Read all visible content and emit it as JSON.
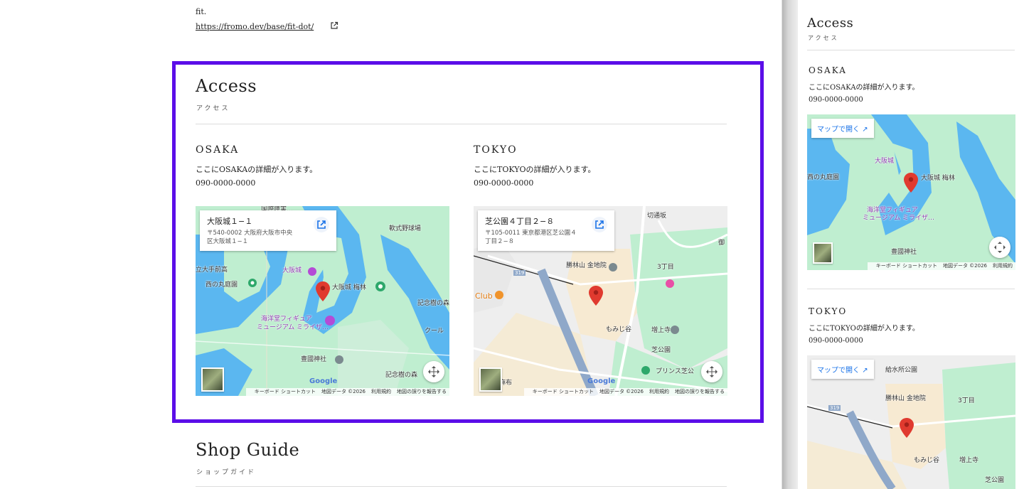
{
  "top": {
    "text": "fit.",
    "link": "https://fromo.dev/base/fit-dot/"
  },
  "access": {
    "title": "Access",
    "subtitle": "アクセス",
    "locations": [
      {
        "name": "OSAKA",
        "desc": "ここにOSAKAの詳細が入ります。",
        "phone": "090-0000-0000",
        "map": {
          "card_title": "大阪城１−１",
          "card_addr1": "〒540-0002 大阪府大阪市中央",
          "card_addr2": "区大阪城１−１",
          "labels": [
            "大阪城",
            "大阪城 梅林",
            "西の丸庭園",
            "立大手前高",
            "海洋堂フィギュア",
            "ミュージアム ミライザ…",
            "豊國神社",
            "軟式野球場",
            "記念樹の森",
            "クール",
            "記念樹の森",
            "国際障害…"
          ],
          "open_label": "マップで開く"
        }
      },
      {
        "name": "TOKYO",
        "desc": "ここにTOKYOの詳細が入ります。",
        "phone": "090-0000-0000",
        "map": {
          "card_title": "芝公園４丁目２−８",
          "card_addr1": "〒105-0011 東京都港区芝公園４",
          "card_addr2": "丁目２−８",
          "labels": [
            "勝林山 金地院",
            "3丁目",
            "もみじ谷",
            "増上寺",
            "芝公園",
            "プリンス芝公",
            "麻布",
            "Club",
            "319",
            "切通坂",
            "御",
            "給水所公園"
          ],
          "open_label": "マップで開く"
        }
      }
    ]
  },
  "map_common": {
    "google": "Google",
    "attribution": [
      "キーボード ショートカット",
      "地図データ ©2026",
      "利用規約",
      "地図の誤りを報告する"
    ]
  },
  "shop_guide": {
    "title": "Shop Guide",
    "subtitle": "ショップガイド"
  },
  "colors": {
    "highlight": "#5b0ee8",
    "map_green": "#bfeed0",
    "water": "#5bb7f0",
    "pin": "#e03a2f"
  }
}
